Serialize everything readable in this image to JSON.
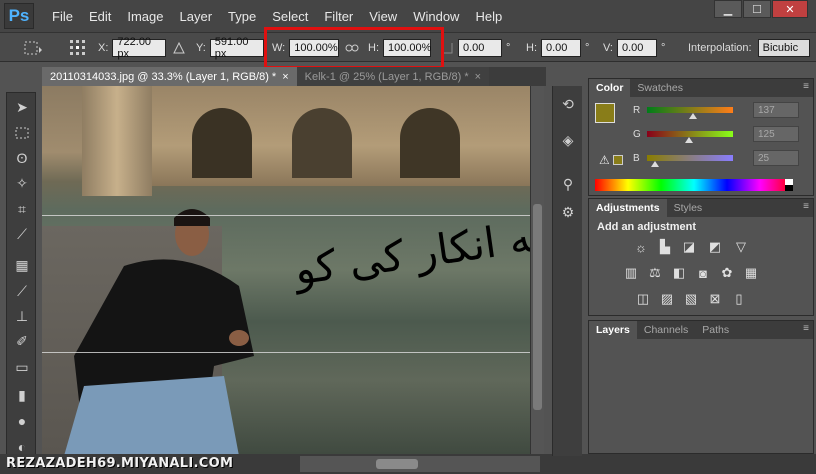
{
  "app": {
    "logo": "Ps",
    "menu": [
      "File",
      "Edit",
      "Image",
      "Layer",
      "Type",
      "Select",
      "Filter",
      "View",
      "Window",
      "Help"
    ],
    "window_controls": {
      "minimize": "▁",
      "maximize": "☐",
      "close": "✕"
    }
  },
  "options_bar": {
    "x_label": "X:",
    "x_value": "722.00 px",
    "y_label": "Y:",
    "y_value": "591.00 px",
    "w_label": "W:",
    "w_value": "100.00%",
    "h_label": "H:",
    "h_value": "100.00%",
    "angle_value": "0.00",
    "angle_unit": "°",
    "hskew_label": "H:",
    "hskew_value": "0.00",
    "vskew_label": "V:",
    "vskew_value": "0.00",
    "interpolation_label": "Interpolation:",
    "interpolation_value": "Bicubic"
  },
  "documents": {
    "tabs": [
      {
        "label": "20110314033.jpg @ 33.3% (Layer 1, RGB/8) *",
        "active": true
      },
      {
        "label": "Kelk-1 @ 25% (Layer 1, RGB/8) *",
        "active": false
      }
    ],
    "close_glyph": "×"
  },
  "canvas": {
    "overlay_text": "جرم قشکی است به انکار کی کو"
  },
  "watermark": "REZAZADEH69.MIYANALI.COM",
  "panels": {
    "color": {
      "tabs": [
        "Color",
        "Swatches"
      ],
      "channels": [
        {
          "label": "R",
          "value": "137",
          "fraction": 0.537
        },
        {
          "label": "G",
          "value": "125",
          "fraction": 0.49
        },
        {
          "label": "B",
          "value": "25",
          "fraction": 0.098
        }
      ],
      "foreground_color": "#897d19"
    },
    "adjustments": {
      "tabs": [
        "Adjustments",
        "Styles"
      ],
      "heading": "Add an adjustment"
    },
    "layers": {
      "tabs": [
        "Layers",
        "Channels",
        "Paths"
      ]
    },
    "menu_glyph": "≡"
  }
}
